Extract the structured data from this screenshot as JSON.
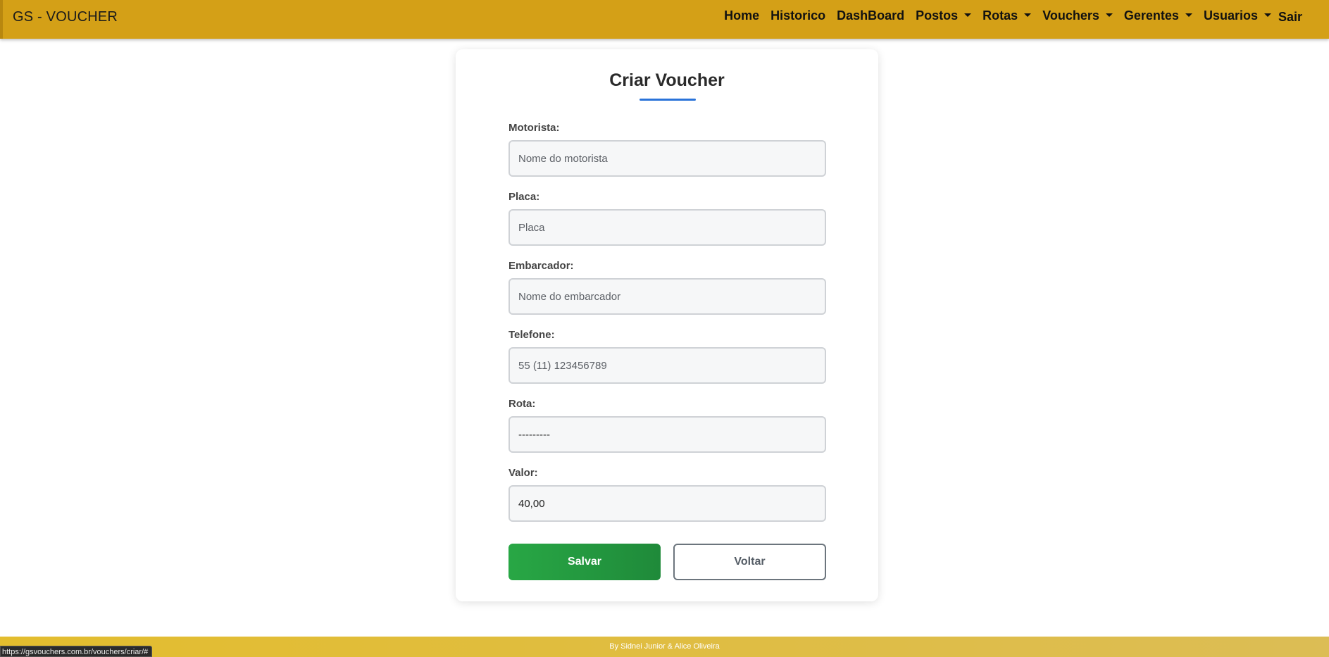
{
  "navbar": {
    "brand": "GS - VOUCHER",
    "links": {
      "home": "Home",
      "historico": "Historico",
      "dashboard": "DashBoard",
      "postos": "Postos",
      "rotas": "Rotas",
      "vouchers": "Vouchers",
      "gerentes": "Gerentes",
      "usuarios": "Usuarios",
      "sair": "Sair"
    },
    "color": "#d4a017"
  },
  "form": {
    "title": "Criar Voucher",
    "title_accent": "#2a73d9",
    "motorista": {
      "label": "Motorista:",
      "placeholder": "Nome do motorista",
      "value": ""
    },
    "placa": {
      "label": "Placa:",
      "placeholder": "Placa",
      "value": ""
    },
    "embarcador": {
      "label": "Embarcador:",
      "placeholder": "Nome do embarcador",
      "value": ""
    },
    "telefone": {
      "label": "Telefone:",
      "placeholder": "55 (11) 123456789",
      "value": ""
    },
    "rota": {
      "label": "Rota:",
      "selected": "---------"
    },
    "valor": {
      "label": "Valor:",
      "value": "40,00"
    },
    "save_label": "Salvar",
    "back_label": "Voltar"
  },
  "footer": {
    "text": "By Sidnei Junior & Alice Oliveira"
  },
  "status_bar": {
    "url": "https://gsvouchers.com.br/vouchers/criar/#"
  }
}
